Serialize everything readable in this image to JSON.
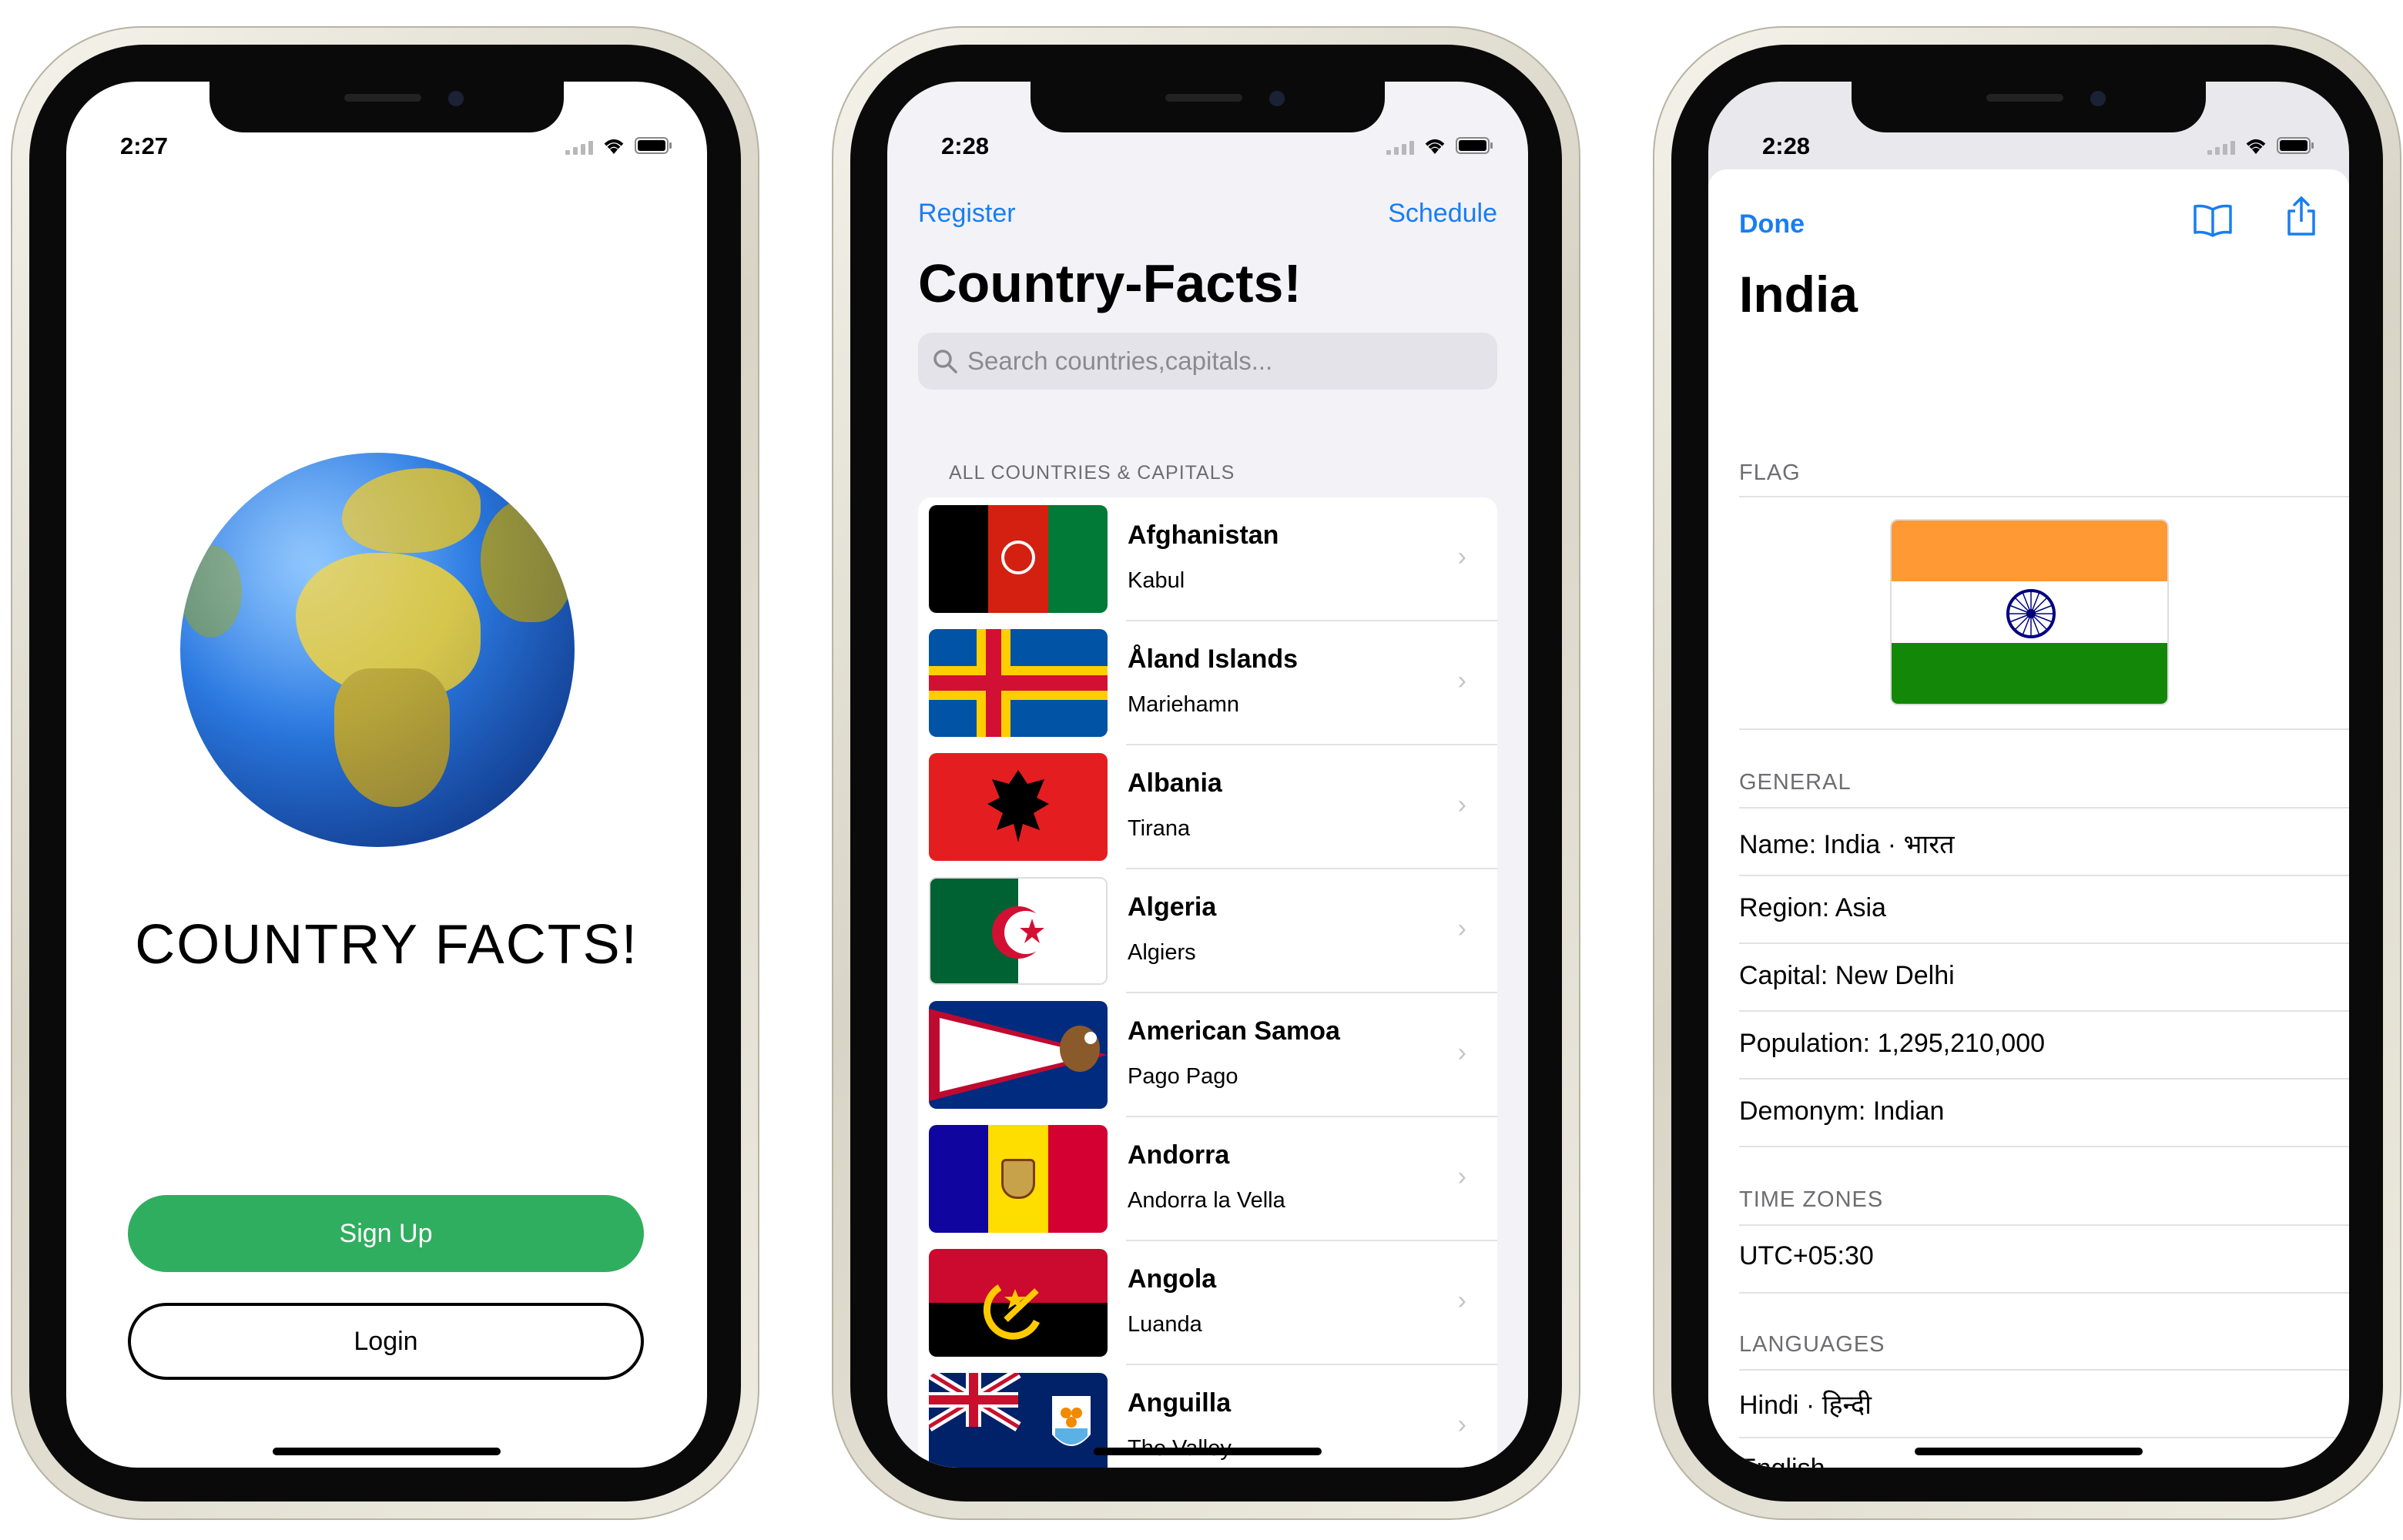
{
  "screen1": {
    "time": "2:27",
    "title": "COUNTRY FACTS!",
    "signup_label": "Sign Up",
    "login_label": "Login"
  },
  "screen2": {
    "time": "2:28",
    "nav_left": "Register",
    "nav_right": "Schedule",
    "title": "Country-Facts!",
    "search_placeholder": "Search countries,capitals...",
    "section_header": "ALL COUNTRIES & CAPITALS",
    "countries": [
      {
        "name": "Afghanistan",
        "capital": "Kabul"
      },
      {
        "name": "Åland Islands",
        "capital": "Mariehamn"
      },
      {
        "name": "Albania",
        "capital": "Tirana"
      },
      {
        "name": "Algeria",
        "capital": "Algiers"
      },
      {
        "name": "American Samoa",
        "capital": "Pago Pago"
      },
      {
        "name": "Andorra",
        "capital": "Andorra la Vella"
      },
      {
        "name": "Angola",
        "capital": "Luanda"
      },
      {
        "name": "Anguilla",
        "capital": "The Valley"
      }
    ]
  },
  "screen3": {
    "time": "2:28",
    "done_label": "Done",
    "title": "India",
    "flag_header": "FLAG",
    "general_header": "GENERAL",
    "general": [
      "Name: India · भारत",
      "Region: Asia",
      "Capital: New Delhi",
      "Population: 1,295,210,000",
      "Demonym: Indian"
    ],
    "timezones_header": "TIME ZONES",
    "timezones": [
      "UTC+05:30"
    ],
    "languages_header": "LANGUAGES",
    "languages": [
      "Hindi · हिन्दी",
      "English"
    ]
  },
  "colors": {
    "accent": "#1a7df0",
    "signup_green": "#2fae5f"
  },
  "icons": [
    "search-icon",
    "chevron-right-icon",
    "book-icon",
    "share-icon",
    "wifi-icon",
    "battery-icon"
  ]
}
